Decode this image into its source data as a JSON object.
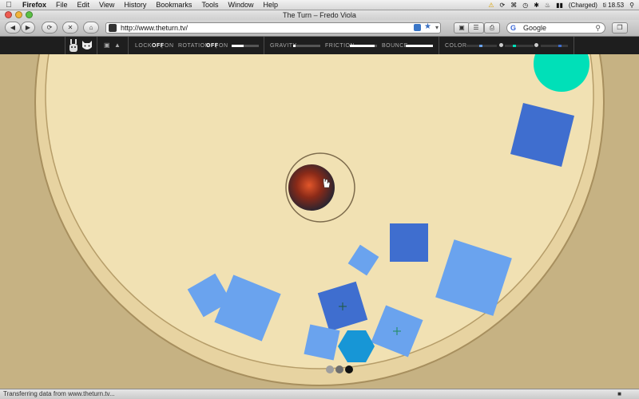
{
  "menubar": {
    "app": "Firefox",
    "items": [
      "File",
      "Edit",
      "View",
      "History",
      "Bookmarks",
      "Tools",
      "Window",
      "Help"
    ],
    "battery": "(Charged)",
    "clock": "ti 18.53"
  },
  "window": {
    "title": "The Turn – Fredo Viola"
  },
  "toolbar": {
    "url": "http://www.theturn.tv/",
    "search_placeholder": "Google"
  },
  "controls": {
    "lock_label": "LOCK",
    "lock_off": "OFF",
    "lock_on": "ON",
    "rotation_label": "ROTATION",
    "rotation_off": "OFF",
    "rotation_on": "ON",
    "gravity_label": "GRAVITY",
    "friction_label": "FRICTION",
    "bounce_label": "BOUNCE",
    "color_label": "COLOR",
    "rotation_level": 0.45,
    "gravity_level": 0.1,
    "friction_level": 0.9,
    "bounce_level": 1.0
  },
  "colors": {
    "shape_light": "#6aa3ee",
    "shape_dark": "#3f6ecf",
    "teal": "#00e0b8",
    "hexagon": "#1796d6",
    "paper": "#f0dfb0"
  },
  "icons": [
    "apple-icon",
    "back-icon",
    "forward-icon",
    "reload-icon",
    "stop-icon",
    "home-icon",
    "rss-icon",
    "bookmark-star-icon",
    "screenshot-icon",
    "print-icon",
    "fullscreen-icon",
    "sound-icon"
  ],
  "status": {
    "text": "Transferring data from www.theturn.tv..."
  }
}
